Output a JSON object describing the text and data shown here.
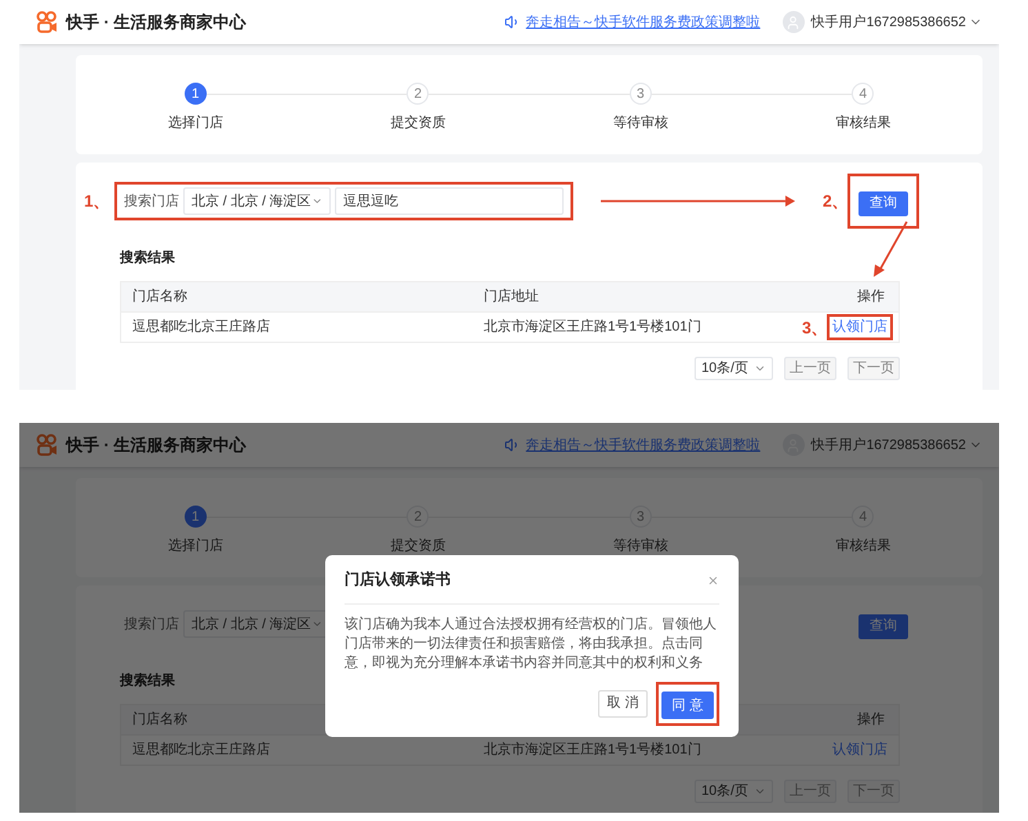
{
  "screens": [
    {
      "header": {
        "brand": "快手 · 生活服务商家中心",
        "notice": "奔走相告～快手软件服务费政策调整啦",
        "user": "快手用户1672985386652"
      },
      "steps": [
        {
          "number": "1",
          "label": "选择门店",
          "selected": true
        },
        {
          "number": "2",
          "label": "提交资质",
          "selected": false
        },
        {
          "number": "3",
          "label": "等待审核",
          "selected": false
        },
        {
          "number": "4",
          "label": "审核结果",
          "selected": false
        }
      ],
      "search": {
        "label": "搜索门店",
        "region": "北京 / 北京 / 海淀区",
        "value": "逗思逗吃",
        "button": "查询"
      },
      "results": {
        "title": "搜索结果",
        "name_heading": "门店名称",
        "address_heading": "门店地址",
        "action_heading": "操作",
        "rows": [
          {
            "name": "逗思都吃北京王庄路店",
            "address": "北京市海淀区王庄路1号1号楼101门",
            "action": "认领门店"
          }
        ]
      },
      "pagination": {
        "page_size": "10条/页",
        "buttons": [
          {
            "label": "上一页",
            "disabled": true
          },
          {
            "label": "下一页",
            "disabled": true
          }
        ]
      },
      "annotations": [
        "1、",
        "2、",
        "3、"
      ]
    },
    {
      "header": {
        "brand": "快手 · 生活服务商家中心",
        "notice": "奔走相告～快手软件服务费政策调整啦",
        "user": "快手用户1672985386652"
      },
      "steps": [
        {
          "number": "1",
          "label": "选择门店",
          "selected": true
        },
        {
          "number": "2",
          "label": "提交资质",
          "selected": false
        },
        {
          "number": "3",
          "label": "等待审核",
          "selected": false
        },
        {
          "number": "4",
          "label": "审核结果",
          "selected": false
        }
      ],
      "search": {
        "label": "搜索门店",
        "region": "北京 / 北京 / 海淀区",
        "button": "查询"
      },
      "results": {
        "title": "搜索结果",
        "name_heading": "门店名称",
        "action_heading": "操作",
        "rows": [
          {
            "name": "逗思都吃北京王庄路店",
            "address": "北京市海淀区王庄路1号1号楼101门",
            "action": "认领门店"
          }
        ]
      },
      "pagination": {
        "page_size": "10条/页",
        "buttons": [
          {
            "label": "上一页",
            "disabled": true
          },
          {
            "label": "下一页",
            "disabled": true
          }
        ]
      },
      "modal": {
        "title": "门店认领承诺书",
        "body": "该门店确为我本人通过合法授权拥有经营权的门店。冒领他人门店带来的一切法律责任和损害赔偿，将由我承担。点击同意，即视为充分理解本承诺书内容并同意其中的权利和义务",
        "cancel": "取 消",
        "confirm": "同 意",
        "confirm_highlighted": true
      }
    }
  ]
}
